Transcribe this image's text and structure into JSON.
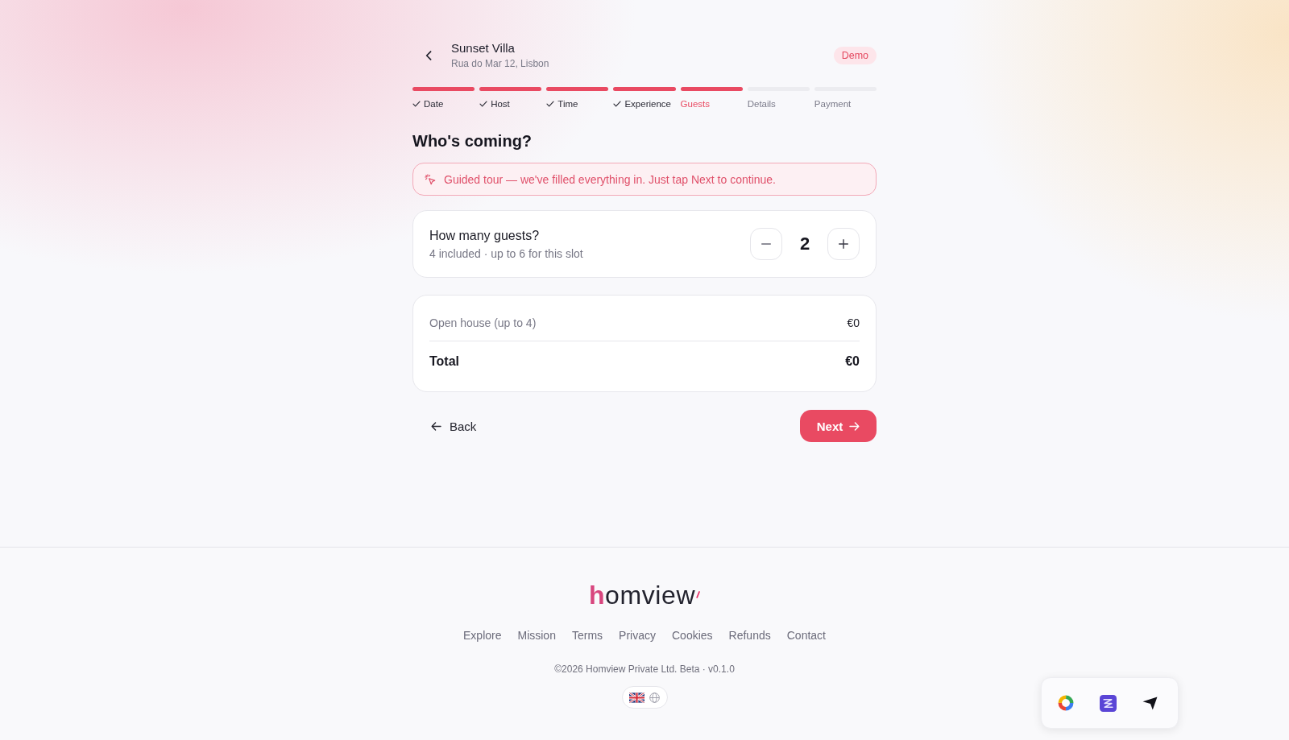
{
  "header": {
    "title": "Sunset Villa",
    "subtitle": "Rua do Mar 12, Lisbon",
    "badge": "Demo"
  },
  "steps": [
    {
      "label": "Date",
      "completed": true,
      "selected": false
    },
    {
      "label": "Host",
      "completed": true,
      "selected": false
    },
    {
      "label": "Time",
      "completed": true,
      "selected": false
    },
    {
      "label": "Experience",
      "completed": true,
      "selected": false
    },
    {
      "label": "Guests",
      "completed": false,
      "selected": true
    },
    {
      "label": "Details",
      "completed": false,
      "selected": false
    },
    {
      "label": "Payment",
      "completed": false,
      "selected": false
    }
  ],
  "heading": "Who's coming?",
  "notice": "Guided tour — we've filled everything in. Just tap Next to continue.",
  "guests": {
    "title": "How many guests?",
    "note": "4 included · up to 6 for this slot",
    "count": "2"
  },
  "price_rows": [
    {
      "kind": "item",
      "label": "Open house (up to 4)",
      "amount": "€0"
    },
    {
      "kind": "total",
      "label": "Total",
      "amount": "€0"
    }
  ],
  "actions": {
    "back": "Back",
    "next": "Next"
  },
  "footer": {
    "logo": "homview",
    "links": [
      "Explore",
      "Mission",
      "Terms",
      "Privacy",
      "Cookies",
      "Refunds",
      "Contact"
    ],
    "copyright": "©2026 Homview Private Ltd. Beta · v0.1.0"
  }
}
